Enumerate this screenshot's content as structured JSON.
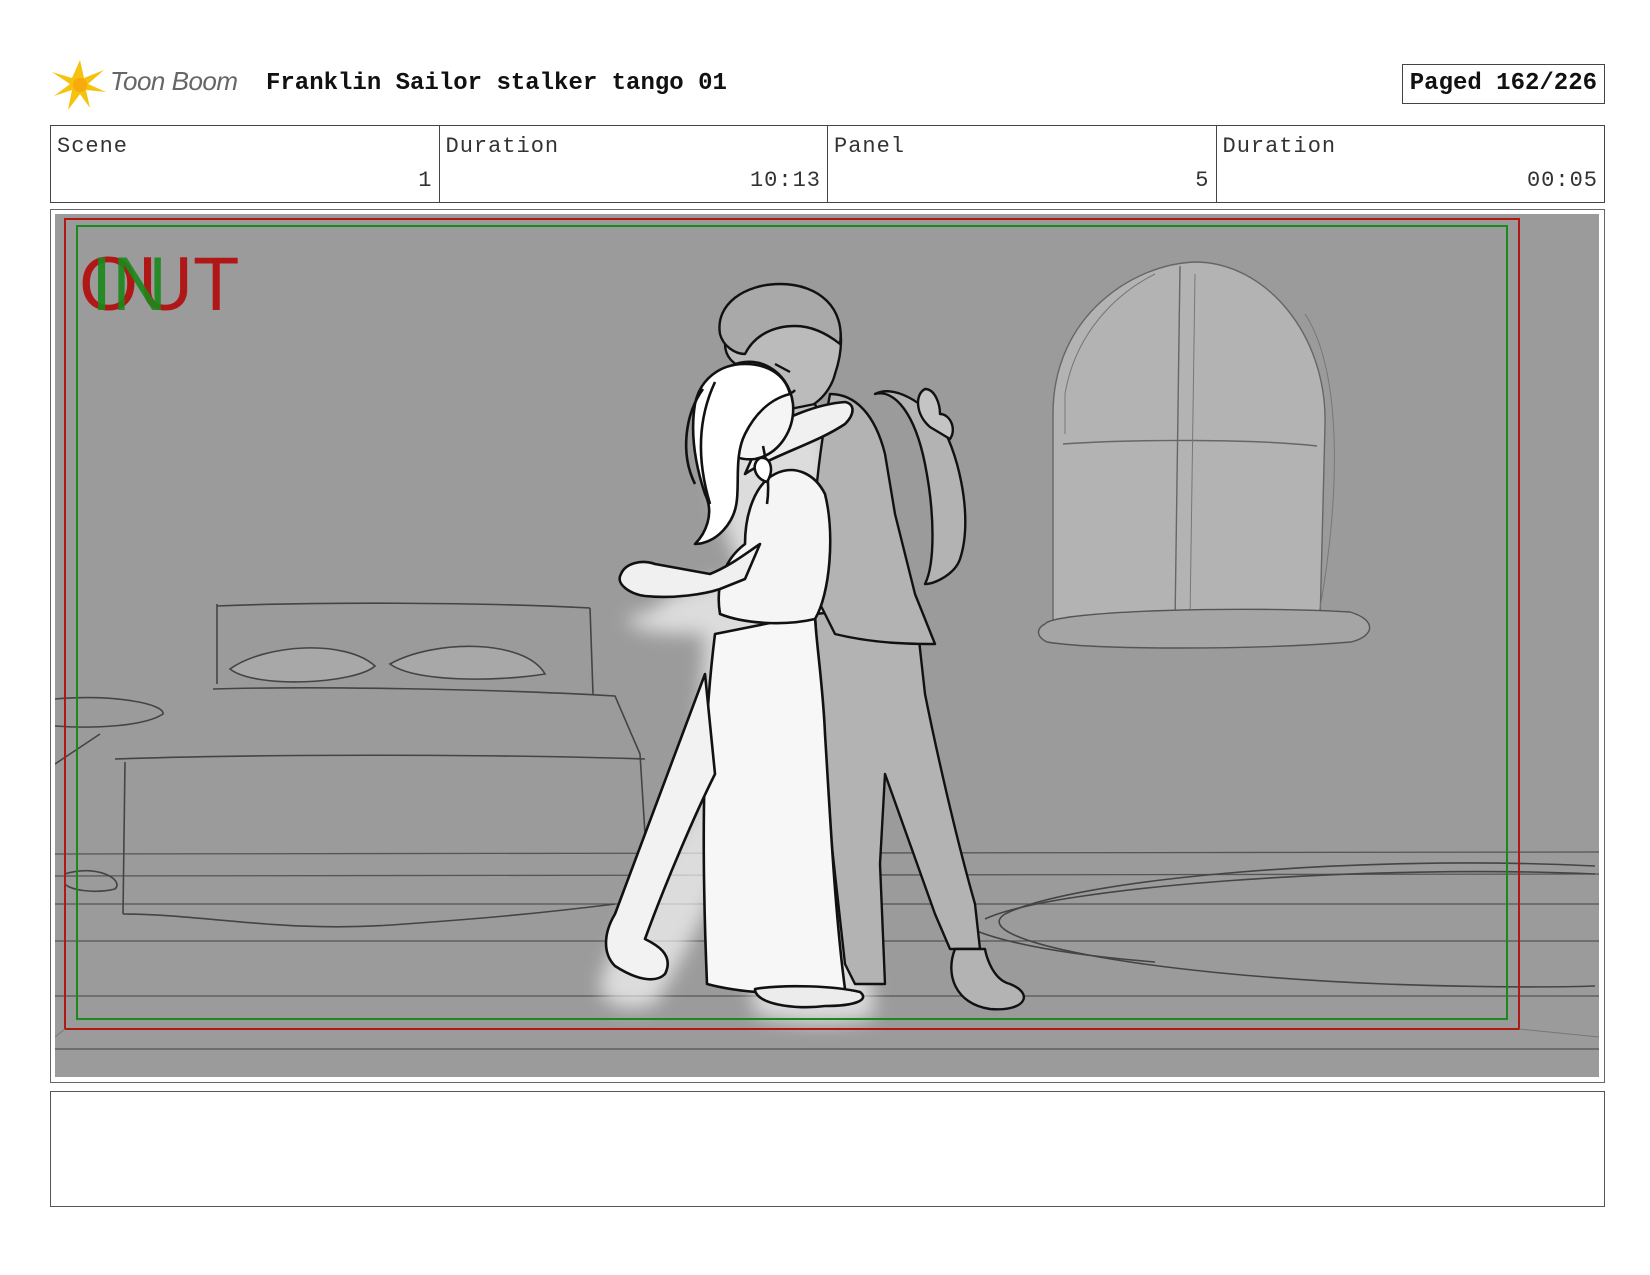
{
  "header": {
    "logo_text": "Toon Boom",
    "title": "Franklin Sailor stalker tango 01",
    "page_counter": "Paged 162/226"
  },
  "info": {
    "scene_label": "Scene",
    "scene_value": "1",
    "scene_duration_label": "Duration",
    "scene_duration_value": "10:13",
    "panel_label": "Panel",
    "panel_value": "5",
    "panel_duration_label": "Duration",
    "panel_duration_value": "00:05"
  },
  "panel": {
    "overlay_in": "IN",
    "overlay_out": "OUT",
    "colors": {
      "safe_frame": "#b01818",
      "action_frame": "#1a8a1a",
      "background": "#9b9b9b"
    }
  },
  "notes": {
    "text": ""
  }
}
